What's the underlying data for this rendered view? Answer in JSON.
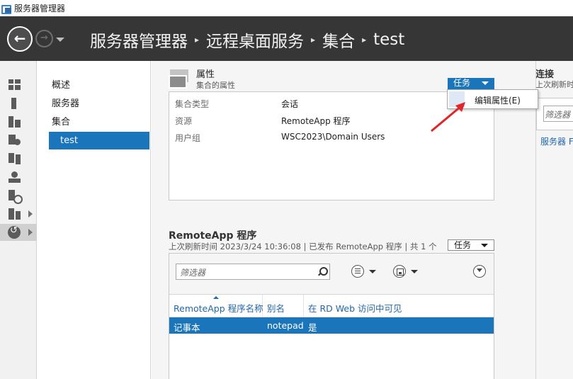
{
  "window": {
    "title": "服务器管理器"
  },
  "breadcrumb": [
    "服务器管理器",
    "远程桌面服务",
    "集合",
    "test"
  ],
  "breadcrumb_sep": "▸",
  "nav": {
    "back": "←",
    "forward": "→"
  },
  "subnav": {
    "items": [
      {
        "label": "概述"
      },
      {
        "label": "服务器"
      },
      {
        "label": "集合"
      },
      {
        "label": "test"
      }
    ]
  },
  "properties": {
    "title": "属性",
    "subtitle": "集合的属性",
    "tasks_label": "任务",
    "rows": [
      {
        "key": "集合类型",
        "value": "会话"
      },
      {
        "key": "资源",
        "value": "RemoteApp 程序"
      },
      {
        "key": "用户组",
        "value": "WSC2023\\Domain Users"
      }
    ]
  },
  "dropdown": {
    "items": [
      {
        "label": "编辑属性(E)"
      }
    ]
  },
  "remoteapp": {
    "title": "RemoteApp 程序",
    "status": "上次刷新时间 2023/3/24 10:36:08 | 已发布 RemoteApp 程序 | 共 1 个",
    "tasks_label": "任务",
    "filter_placeholder": "筛选器",
    "columns": [
      "RemoteApp 程序名称",
      "别名",
      "在 RD Web 访问中可见"
    ],
    "rows": [
      {
        "name": "记事本",
        "alias": "notepad",
        "visible": "是"
      }
    ]
  },
  "connections": {
    "title": "连接",
    "subtitle": "上次刷新时",
    "filter_placeholder": "筛选器",
    "link": "服务器 FQ"
  },
  "colors": {
    "accent": "#1b75bb",
    "navbar": "#363636",
    "annotation": "#e0262b"
  }
}
